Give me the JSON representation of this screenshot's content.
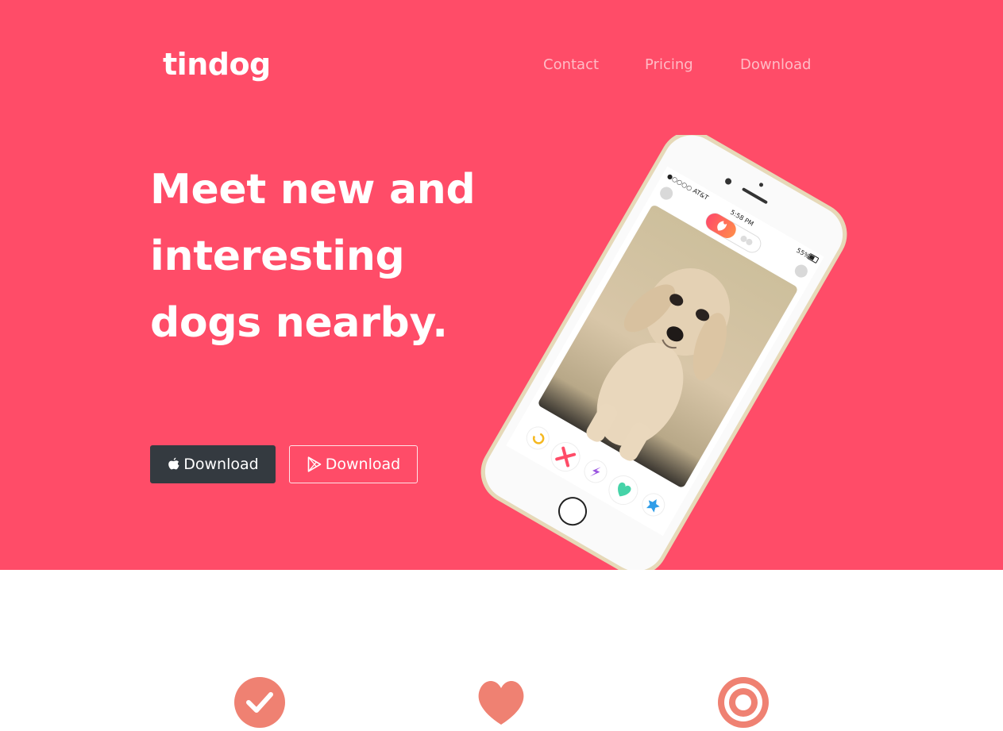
{
  "brand": {
    "name": "tindog"
  },
  "nav": {
    "items": [
      {
        "label": "Contact"
      },
      {
        "label": "Pricing"
      },
      {
        "label": "Download"
      }
    ]
  },
  "hero": {
    "headline": "Meet new and interesting dogs nearby.",
    "buttons": [
      {
        "label": "Download",
        "icon": "apple-icon"
      },
      {
        "label": "Download",
        "icon": "google-play-icon"
      }
    ]
  },
  "phone": {
    "carrier": "●○○○○ AT&T",
    "time": "5:58 PM",
    "battery": "55%",
    "photo": "dog-photo",
    "action_icons": [
      "rewind-icon",
      "nope-icon",
      "boost-icon",
      "like-icon",
      "super-like-icon"
    ]
  },
  "features": {
    "icons": [
      "check-circle-icon",
      "heart-icon",
      "target-icon"
    ]
  },
  "colors": {
    "hero_background": "#ff4c68",
    "dark_button": "#343a40",
    "feature_icon": "#ef8172",
    "white": "#ffffff"
  }
}
